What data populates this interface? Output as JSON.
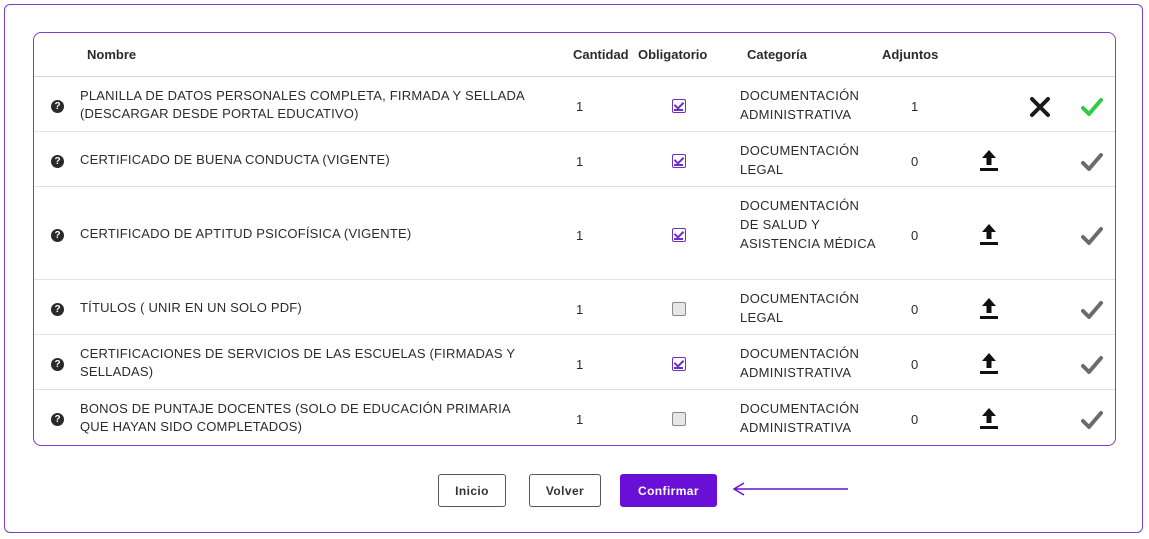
{
  "table": {
    "headers": {
      "nombre": "Nombre",
      "cantidad": "Cantidad",
      "obligatorio": "Obligatorio",
      "categoria": "Categoría",
      "adjuntos": "Adjuntos"
    },
    "rows": [
      {
        "name": "PLANILLA DE DATOS PERSONALES COMPLETA, FIRMADA Y SELLADA (DESCARGAR DESDE PORTAL EDUCATIVO)",
        "quantity": "1",
        "required": true,
        "category": "DOCUMENTACIÓN ADMINISTRATIVA",
        "attachments": "1",
        "state": "uploaded"
      },
      {
        "name": "CERTIFICADO DE BUENA CONDUCTA (VIGENTE)",
        "quantity": "1",
        "required": true,
        "category": "DOCUMENTACIÓN LEGAL",
        "attachments": "0",
        "state": "pending"
      },
      {
        "name": "CERTIFICADO DE APTITUD PSICOFÍSICA (VIGENTE)",
        "quantity": "1",
        "required": true,
        "category": "DOCUMENTACIÓN DE SALUD Y ASISTENCIA MÉDICA",
        "attachments": "0",
        "state": "pending"
      },
      {
        "name": "TÍTULOS ( UNIR EN UN SOLO PDF)",
        "quantity": "1",
        "required": false,
        "category": "DOCUMENTACIÓN LEGAL",
        "attachments": "0",
        "state": "pending"
      },
      {
        "name": "CERTIFICACIONES DE SERVICIOS DE LAS ESCUELAS (FIRMADAS Y SELLADAS)",
        "quantity": "1",
        "required": true,
        "category": "DOCUMENTACIÓN ADMINISTRATIVA",
        "attachments": "0",
        "state": "pending"
      },
      {
        "name": "BONOS DE PUNTAJE DOCENTES (SOLO DE EDUCACIÓN PRIMARIA QUE HAYAN SIDO COMPLETADOS)",
        "quantity": "1",
        "required": false,
        "category": "DOCUMENTACIÓN ADMINISTRATIVA",
        "attachments": "0",
        "state": "pending"
      }
    ]
  },
  "buttons": {
    "inicio": "Inicio",
    "volver": "Volver",
    "confirmar": "Confirmar"
  },
  "icons": {
    "help": "question-circle-icon",
    "upload": "upload-icon",
    "delete": "close-icon",
    "check": "checkmark-icon",
    "pointer": "arrow-left-icon"
  },
  "colors": {
    "accent": "#6a0fd6",
    "border": "#7b3fd0",
    "check_done": "#2ecc40",
    "check_pending": "#6b6b6b"
  }
}
